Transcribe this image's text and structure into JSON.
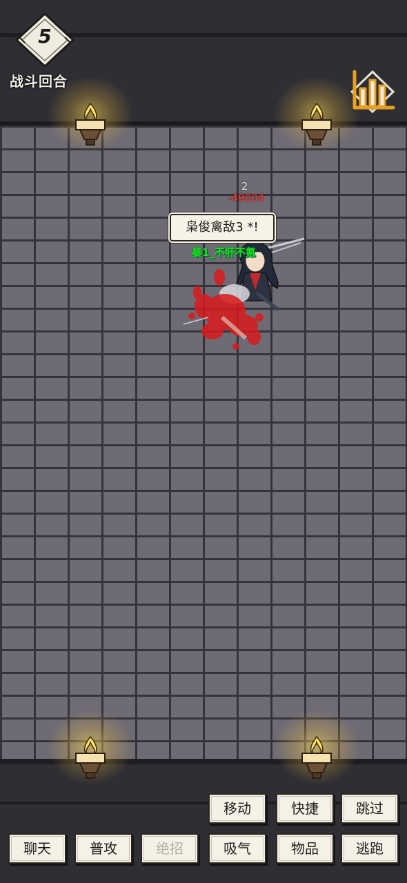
{
  "hud": {
    "round_number": "5",
    "round_label": "战斗回合"
  },
  "combat": {
    "combo_count": "2",
    "damage": "-49004",
    "skill_name": "枭俊禽敌3 *!",
    "buff_text": "暴1_不肝不氪"
  },
  "actions": {
    "row1": [
      {
        "label": "移动",
        "enabled": true
      },
      {
        "label": "快捷",
        "enabled": true
      },
      {
        "label": "跳过",
        "enabled": true
      }
    ],
    "row2": [
      {
        "label": "聊天",
        "enabled": true
      },
      {
        "label": "普攻",
        "enabled": true
      },
      {
        "label": "绝招",
        "enabled": false
      },
      {
        "label": "吸气",
        "enabled": true
      },
      {
        "label": "物品",
        "enabled": true
      },
      {
        "label": "逃跑",
        "enabled": true
      }
    ]
  },
  "colors": {
    "wall": "#6f6b74",
    "mortar": "#35333a",
    "damage": "#ff3b3b",
    "buff": "#1be01b",
    "button_bg": "#f6f1e6"
  }
}
